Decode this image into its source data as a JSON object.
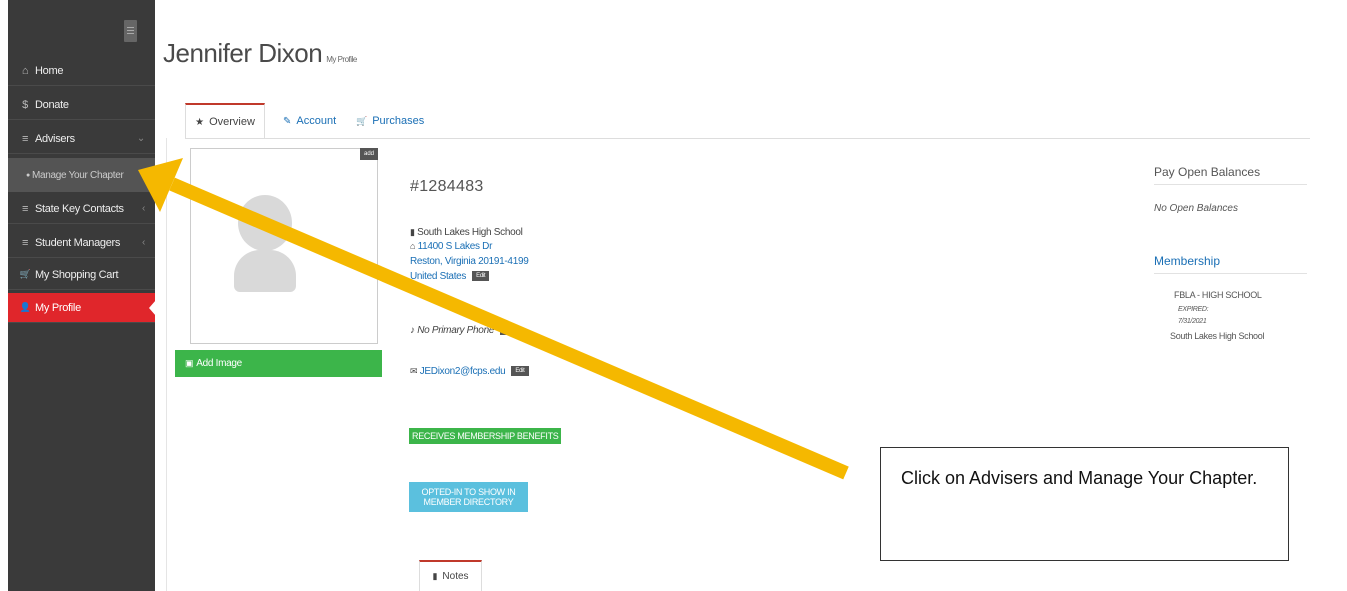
{
  "sidebar": {
    "items": [
      {
        "icon": "home-icon",
        "glyph": "⌂",
        "label": "Home"
      },
      {
        "icon": "dollar-icon",
        "glyph": "$",
        "label": "Donate"
      },
      {
        "icon": "list-icon",
        "glyph": "≡",
        "label": "Advisers",
        "chevron": "⌄"
      },
      {
        "icon": "list-icon",
        "glyph": "≡",
        "label": "State Key Contacts",
        "chevron": "‹"
      },
      {
        "icon": "list-icon",
        "glyph": "≡",
        "label": "Student Managers",
        "chevron": "‹"
      },
      {
        "icon": "cart-icon",
        "glyph": "🛒",
        "label": "My Shopping Cart"
      },
      {
        "icon": "user-icon",
        "glyph": "👤",
        "label": "My Profile"
      }
    ],
    "submenu_item": {
      "icon": "info-icon",
      "glyph": "●",
      "label": "Manage Your Chapter"
    },
    "active_color": "#e0262b"
  },
  "header": {
    "name": "Jennifer Dixon",
    "subtitle": "My Profile"
  },
  "tabs": [
    {
      "icon": "star-icon",
      "glyph": "★",
      "label": "Overview"
    },
    {
      "icon": "edit-icon",
      "glyph": "✎",
      "label": "Account"
    },
    {
      "icon": "cart-icon",
      "glyph": "🛒",
      "label": "Purchases"
    }
  ],
  "profile": {
    "add_label": "add",
    "add_image_label": "Add Image",
    "member_id": "#1284483",
    "school": "South Lakes High School",
    "address_line1": "11400 S Lakes Dr",
    "address_line2": "Reston, Virginia 20191-4199",
    "country": "United States",
    "edit_label": "Edit",
    "phone": "No Primary Phone",
    "phone_add_label": "Add",
    "email": "JEDixon2@fcps.edu",
    "benefits_badge": "RECEIVES MEMBERSHIP BENEFITS",
    "directory_badge_line1": "OPTED-IN TO SHOW IN",
    "directory_badge_line2": "MEMBER DIRECTORY",
    "notes_tab": "Notes"
  },
  "right_panel": {
    "balances_heading": "Pay Open Balances",
    "balances_text": "No Open Balances",
    "membership_heading": "Membership",
    "membership_type": "FBLA - HIGH SCHOOL",
    "expired_label": "EXPIRED:",
    "expired_date": "7/31/2021",
    "membership_school": "South Lakes High School"
  },
  "callout": {
    "text": "Click on Advisers and Manage Your Chapter."
  },
  "colors": {
    "arrow": "#f5b800",
    "green": "#3cb54a",
    "blue": "#5bc0de",
    "link": "#1a6fb5"
  }
}
